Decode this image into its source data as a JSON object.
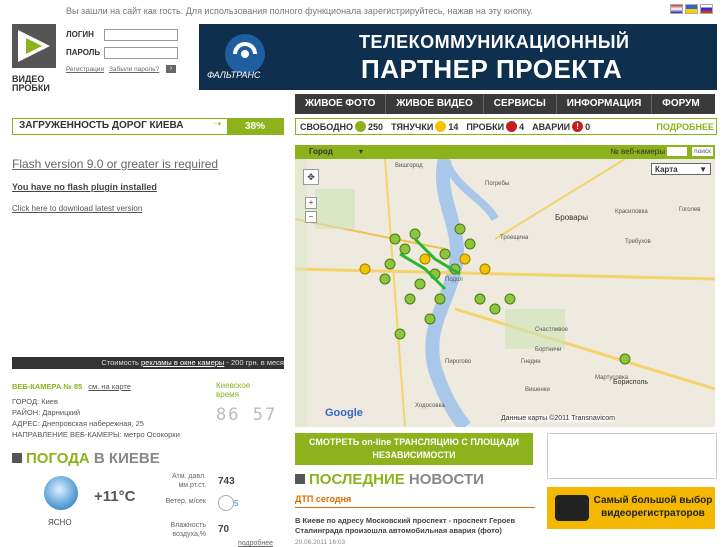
{
  "header": {
    "guest_notice": "Вы зашли на сайт как гость. Для использования полного функционала зарегистрируйтесь, нажав на эту кнопку.",
    "login_label": "ЛОГИН",
    "password_label": "ПАРОЛЬ",
    "register_link": "Регистрация",
    "forgot_link": "Забыли пароль?",
    "logo_text_1": "ВИДЕО",
    "logo_text_2": "ПРОБКИ"
  },
  "banner": {
    "line1": "ТЕЛЕКОММУНИКАЦИОННЫЙ",
    "line2": "ПАРТНЕР ПРОЕКТА",
    "brand": "ФАЛЬТРАНС"
  },
  "nav": {
    "items": [
      "ЖИВОЕ ФОТО",
      "ЖИВОЕ ВИДЕО",
      "СЕРВИСЫ",
      "ИНФОРМАЦИЯ",
      "ФОРУМ"
    ]
  },
  "traffic": {
    "label": "ЗАГРУЖЕННОСТЬ ДОРОГ КИЕВА",
    "percent": "38%"
  },
  "status": {
    "free_label": "СВОБОДНО",
    "free_count": "250",
    "slow_label": "ТЯНУЧКИ",
    "slow_count": "14",
    "jam_label": "ПРОБКИ",
    "jam_count": "4",
    "accident_label": "АВАРИИ",
    "accident_count": "0",
    "more": "ПОДРОБНЕЕ"
  },
  "flash": {
    "required": "Flash version 9.0 or greater is required",
    "missing": "You have no flash plugin installed",
    "download": "Click here to download latest version"
  },
  "ad": {
    "text_before": "Стоимость",
    "link": "рекламы в окне камеры",
    "text_after": " - 200 грн. в меся"
  },
  "camera": {
    "title": "ВЕБ-КАМЕРА № 85",
    "map_link": "см. на карте",
    "city": "ГОРОД: Киев",
    "district": "РАЙОН: Дарницкий",
    "address": "АДРЕС: Днепровская набережная, 25",
    "direction": "НАПРАВЛЕНИЕ ВЕБ-КАМЕРЫ: метро Осокорки",
    "clock_label": "Киевское время",
    "clock_time": "86 57"
  },
  "weather": {
    "head_green": "ПОГОДА",
    "head_gray": "В КИЕВЕ",
    "temp": "+11°C",
    "condition": "ЯСНО",
    "pressure_label": "Атм. давл. мм.рт.ст.",
    "pressure": "743",
    "wind_label": "Ветер, м/сек",
    "wind": "5",
    "humidity_label": "Влажность воздуха,%",
    "humidity": "70",
    "more": "подробнее"
  },
  "map": {
    "city_select": "Город",
    "webcam_label": "№ веб-камеры",
    "search_btn": "поиск",
    "type_select": "Карта",
    "copyright": "Данные карты ©2011 Transnavicom",
    "places": [
      "Вишгород",
      "Погребы",
      "Бровары",
      "Троещина",
      "Подол",
      "Киев",
      "Бортничи",
      "Борисполь",
      "Счастливое",
      "Пирогово",
      "Ходосовка",
      "Мартусовка",
      "Гнедин",
      "Вишенки",
      "Красиловка",
      "Гоголев",
      "Требухов"
    ]
  },
  "watch": {
    "line1": "СМОТРЕТЬ on-line ТРАНСЛЯЦИЮ С ПЛОЩАДИ",
    "line2": "НЕЗАВИСИМОСТИ"
  },
  "news": {
    "head_green": "ПОСЛЕДНИЕ",
    "head_gray": "НОВОСТИ",
    "dtp": "ДТП сегодня",
    "item": "В Киеве по адресу Московский проспект - проспект Героев Сталинграда произошла автомобильная авария (фото)",
    "date": "20.06.2011 16:03"
  },
  "dvr_ad": {
    "line1": "Самый большой выбор",
    "line2": "видеорегистраторов"
  },
  "colors": {
    "accent": "#8cb31b",
    "dark": "#3a3a3a",
    "banner": "#0f2f4f"
  }
}
